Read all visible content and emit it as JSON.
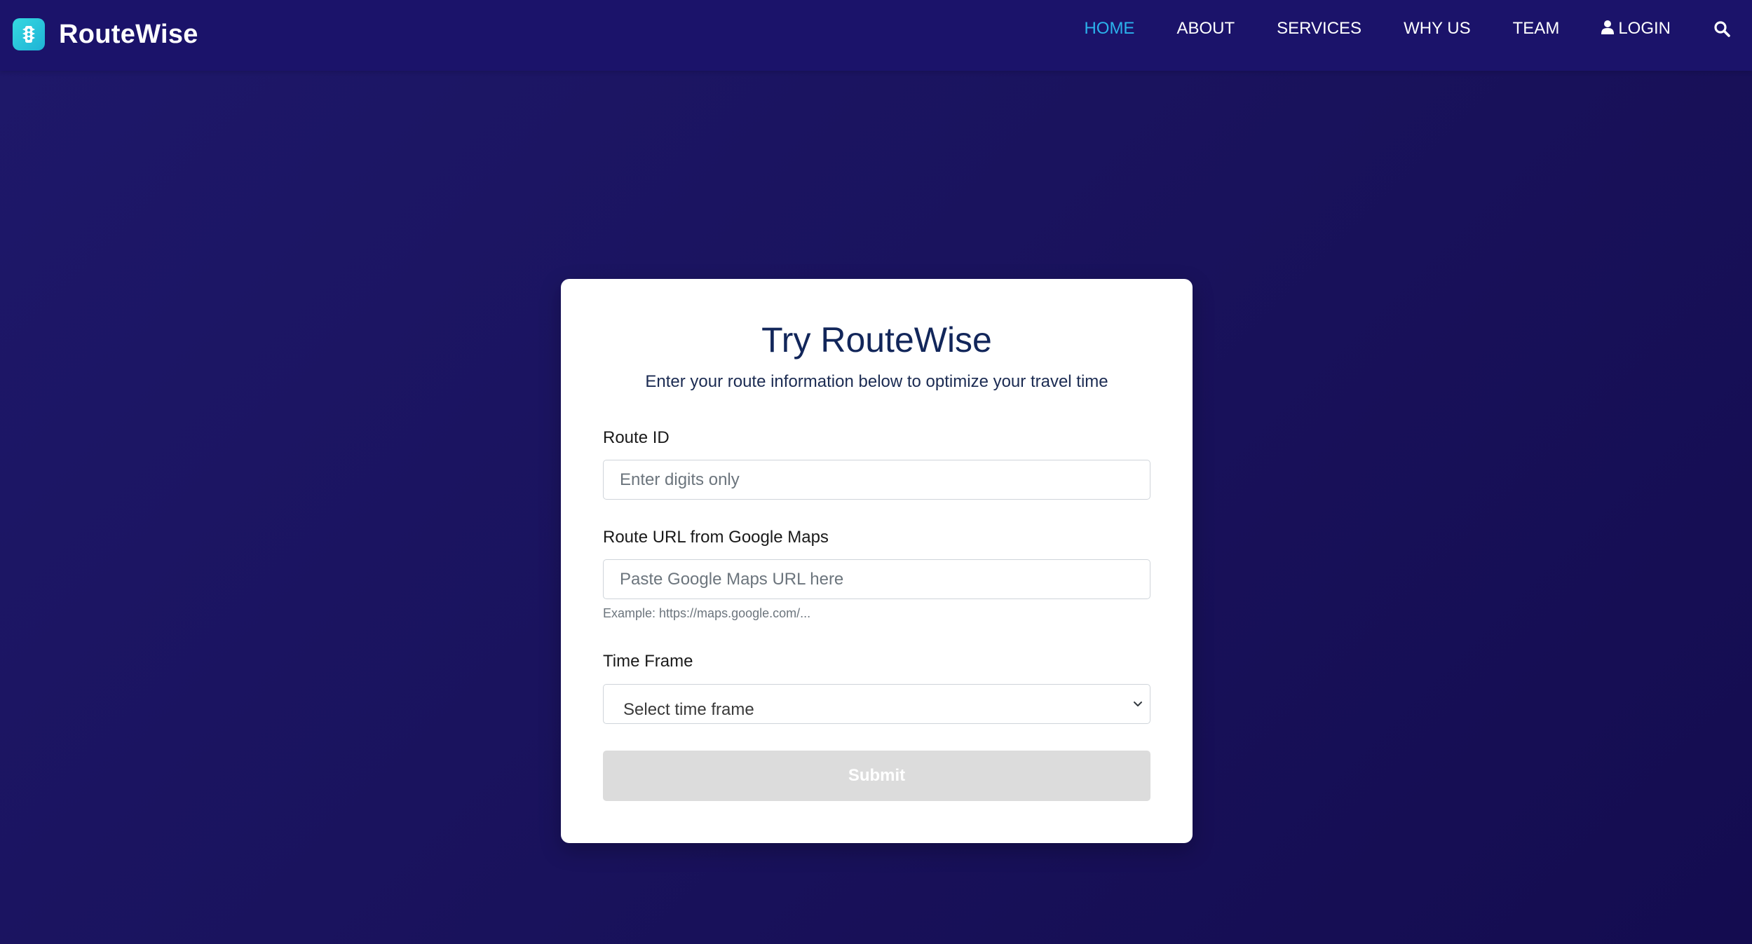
{
  "header": {
    "brand_name": "RouteWise",
    "nav_items": [
      {
        "label": "HOME",
        "active": true
      },
      {
        "label": "ABOUT",
        "active": false
      },
      {
        "label": "SERVICES",
        "active": false
      },
      {
        "label": "WHY US",
        "active": false
      },
      {
        "label": "TEAM",
        "active": false
      },
      {
        "label": "LOGIN",
        "active": false
      }
    ],
    "icons": {
      "logo": "traffic-light-icon",
      "login": "user-icon",
      "search": "search-icon"
    }
  },
  "form": {
    "title": "Try RouteWise",
    "subtitle": "Enter your route information below to optimize your travel time",
    "route_id": {
      "label": "Route ID",
      "placeholder": "Enter digits only",
      "value": ""
    },
    "route_url": {
      "label": "Route URL from Google Maps",
      "placeholder": "Paste Google Maps URL here",
      "value": "",
      "help": "Example: https://maps.google.com/..."
    },
    "time_frame": {
      "label": "Time Frame",
      "selected": "Select time frame"
    },
    "submit_label": "Submit"
  },
  "colors": {
    "nav_active": "#2bb3ec",
    "background": "#1b146a",
    "card": "#ffffff",
    "title_text": "#12265a",
    "submit_disabled": "#dcdcdc"
  }
}
